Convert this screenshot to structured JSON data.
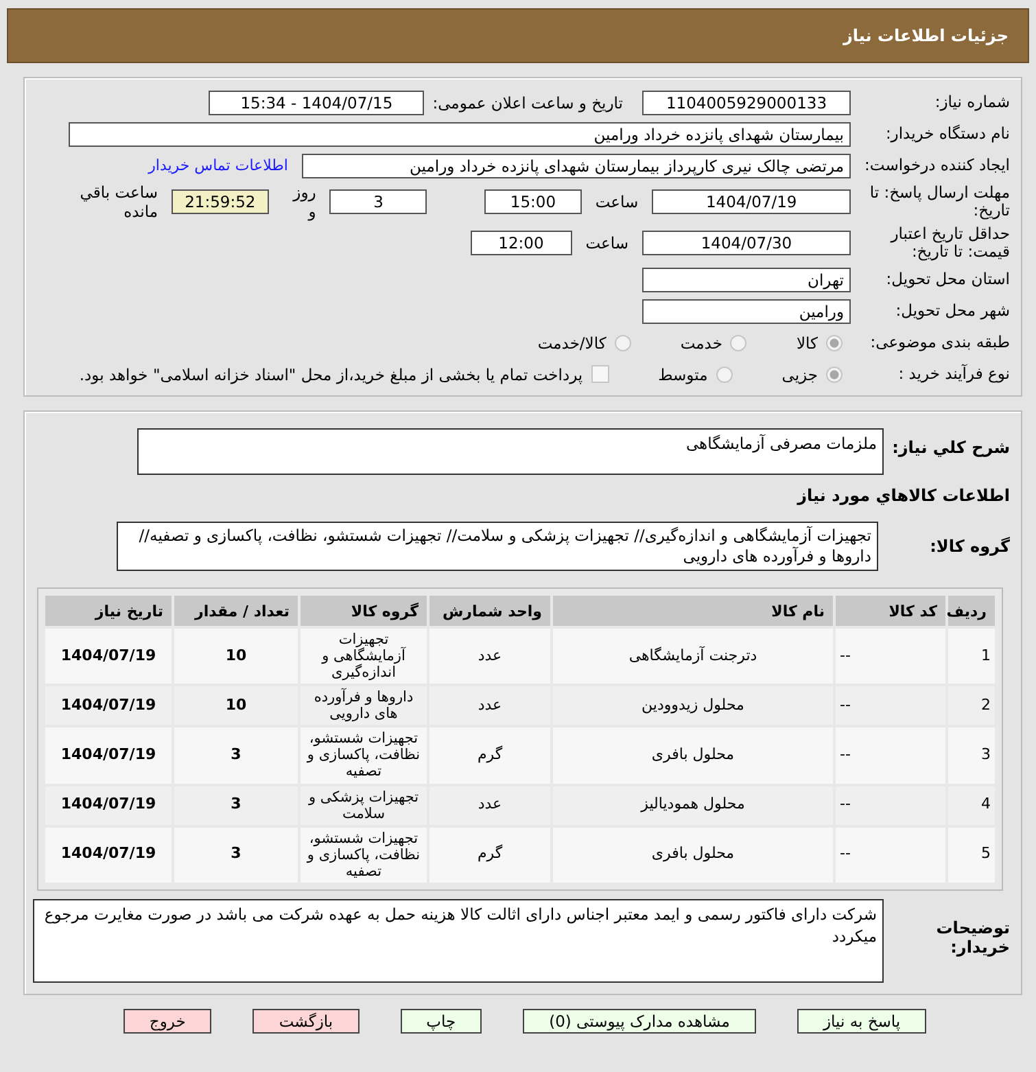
{
  "header": {
    "title": "جزئیات اطلاعات نیاز"
  },
  "need_number": {
    "label": "شماره نیاز:",
    "value": "1104005929000133"
  },
  "announce": {
    "label": "تاریخ و ساعت اعلان عمومی:",
    "value": "1404/07/15 - 15:34"
  },
  "buyer_org": {
    "label": "نام دستگاه خریدار:",
    "value": "بیمارستان شهدای پانزده خرداد ورامین"
  },
  "requester": {
    "label": "ایجاد کننده درخواست:",
    "value": "مرتضی چالک نیری کارپرداز بیمارستان شهدای پانزده خرداد ورامین",
    "link": "اطلاعات تماس خریدار"
  },
  "reply_deadline": {
    "label": "مهلت ارسال پاسخ: تا تاریخ:",
    "date": "1404/07/19",
    "time_label": "ساعت",
    "time": "15:00",
    "days": "3",
    "days_label": "روز و",
    "remaining": "21:59:52",
    "remaining_label": "ساعت باقي مانده"
  },
  "price_validity": {
    "label": "حداقل تاریخ اعتبار قیمت: تا تاریخ:",
    "date": "1404/07/30",
    "time_label": "ساعت",
    "time": "12:00"
  },
  "province": {
    "label": "استان محل تحویل:",
    "value": "تهران"
  },
  "city": {
    "label": "شهر محل تحویل:",
    "value": "ورامین"
  },
  "category": {
    "label": "طبقه بندی موضوعی:",
    "options": [
      {
        "label": "کالا",
        "selected": true
      },
      {
        "label": "خدمت",
        "selected": false
      },
      {
        "label": "کالا/خدمت",
        "selected": false
      }
    ]
  },
  "process": {
    "label": "نوع فرآیند خرید :",
    "options": [
      {
        "label": "جزیی",
        "selected": true
      },
      {
        "label": "متوسط",
        "selected": false
      }
    ],
    "treasury": {
      "checked": false,
      "label": "پرداخت تمام یا بخشی از مبلغ خرید،از محل \"اسناد خزانه اسلامی\" خواهد بود."
    }
  },
  "description": {
    "label": "شرح كلي نياز:",
    "value": "ملزمات مصرفی آزمایشگاهی"
  },
  "goods_title": "اطلاعات كالاهاي مورد نياز",
  "goods_group": {
    "label": "گروه كالا:",
    "value": "تجهیزات آزمایشگاهی و اندازه‌گیری// تجهیزات پزشکی و سلامت// تجهیزات شستشو، نظافت، پاکسازی و تصفیه// داروها و فرآورده های دارویی"
  },
  "table": {
    "columns": [
      "ردیف",
      "کد کالا",
      "نام کالا",
      "واحد شمارش",
      "گروه کالا",
      "تعداد / مقدار",
      "تاریخ نیاز"
    ],
    "rows": [
      [
        "1",
        "--",
        "دترجنت آزمایشگاهی",
        "عدد",
        "تجهیزات آزمایشگاهی و اندازه‌گیری",
        "10",
        "1404/07/19"
      ],
      [
        "2",
        "--",
        "محلول زیدوودین",
        "عدد",
        "داروها و فرآورده های دارویی",
        "10",
        "1404/07/19"
      ],
      [
        "3",
        "--",
        "محلول بافری",
        "گرم",
        "تجهیزات شستشو، نظافت، پاکسازی و تصفیه",
        "3",
        "1404/07/19"
      ],
      [
        "4",
        "--",
        "محلول همودیالیز",
        "عدد",
        "تجهیزات پزشکی و سلامت",
        "3",
        "1404/07/19"
      ],
      [
        "5",
        "--",
        "محلول بافری",
        "گرم",
        "تجهیزات شستشو، نظافت، پاکسازی و تصفیه",
        "3",
        "1404/07/19"
      ]
    ]
  },
  "buyer_notes": {
    "label": "توضیحات خریدار:",
    "value": "شرکت دارای فاکتور رسمی و ایمد معتبر اجناس دارای اثالت کالا هزینه حمل به عهده شرکت می باشد در صورت مغایرت مرجوع میکردد"
  },
  "buttons": [
    {
      "label": "پاسخ به نیاز",
      "kind": "primary"
    },
    {
      "label": "مشاهده مدارک پیوستی (0)",
      "kind": "primary"
    },
    {
      "label": "چاپ",
      "kind": "primary"
    },
    {
      "label": "بازگشت",
      "kind": "danger"
    },
    {
      "label": "خروج",
      "kind": "danger"
    }
  ]
}
